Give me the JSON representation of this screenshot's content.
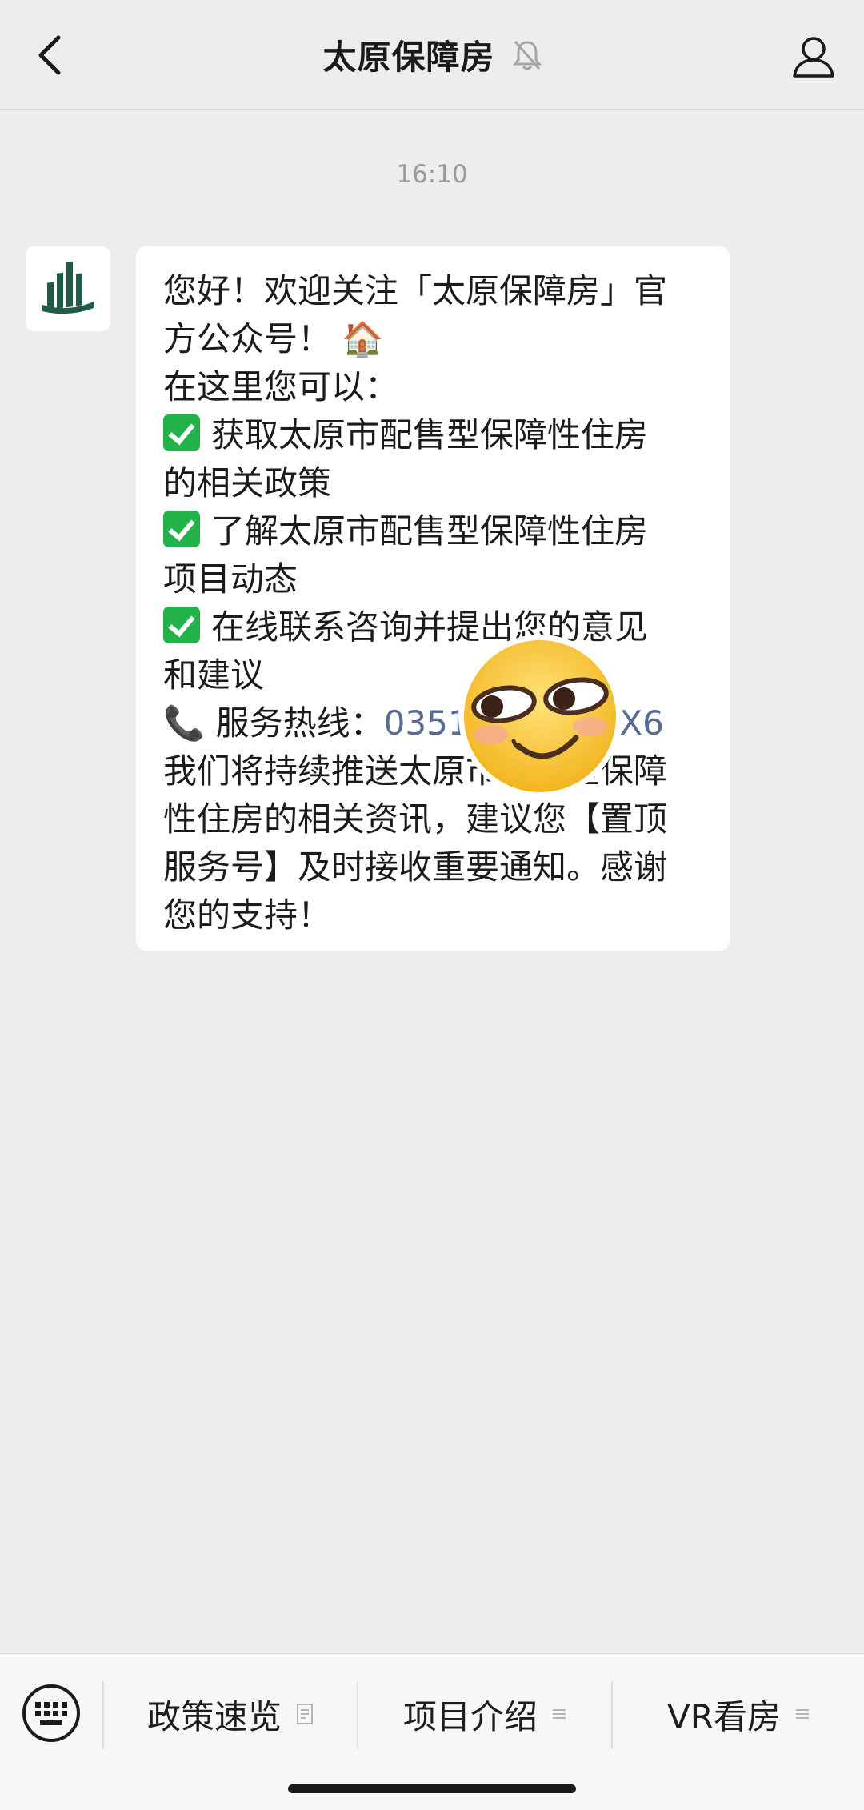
{
  "header": {
    "title": "太原保障房",
    "back_icon": "chevron-left-icon",
    "mute_icon": "bell-muted-icon",
    "profile_icon": "person-icon"
  },
  "chat": {
    "timestamp": "16:10",
    "message_lines": [
      "您好！欢迎关注「太原保障房」官",
      "方公众号！",
      "在这里您可以：",
      "获取太原市配售型保障性住房",
      "的相关政策",
      "了解太原市配售型保障性住房",
      "项目动态",
      "在线联系咨询并提出您的意见",
      "和建议",
      "服务热线：",
      "我们将持续推送太原市配售型保障",
      "性住房的相关资讯，建议您【置顶",
      "服务号】及时接收重要通知。感谢",
      "您的支持！"
    ],
    "hotline_number": "0351-XXXXXXX6",
    "house_emoji": "🏠",
    "phone_emoji": "📞"
  },
  "menu": {
    "items": [
      {
        "label": "政策速览"
      },
      {
        "label": "项目介绍"
      },
      {
        "label": "VR看房"
      }
    ]
  },
  "colors": {
    "background": "#ededed",
    "bubble": "#ffffff",
    "link": "#576b95",
    "brand_green": "#1f5b45"
  }
}
